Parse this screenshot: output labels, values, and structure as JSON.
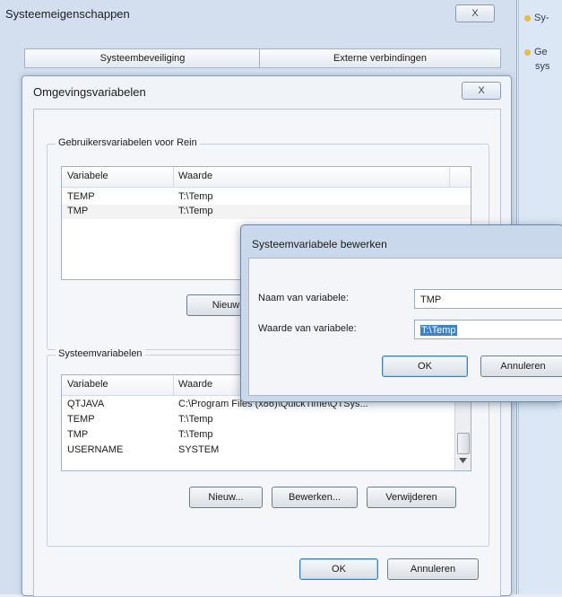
{
  "outer_window": {
    "title": "Systeemeigenschappen",
    "close_glyph": "X",
    "tabs": [
      "Systeembeveiliging",
      "Externe verbindingen"
    ]
  },
  "right_pane": {
    "items": [
      "Sy-",
      "Ge"
    ],
    "item2_sub": "sys"
  },
  "env_dialog": {
    "title": "Omgevingsvariabelen",
    "close_glyph": "X",
    "user_group_label": "Gebruikersvariabelen voor Rein",
    "user_table": {
      "columns": [
        "Variabele",
        "Waarde"
      ],
      "rows": [
        {
          "name": "TEMP",
          "value": "T:\\Temp"
        },
        {
          "name": "TMP",
          "value": "T:\\Temp"
        }
      ]
    },
    "user_new_button": "Nieuw",
    "system_group_label": "Systeemvariabelen",
    "system_table": {
      "columns": [
        "Variabele",
        "Waarde"
      ],
      "rows": [
        {
          "name": "QTJAVA",
          "value": "C:\\Program Files (x86)\\QuickTime\\QTSys..."
        },
        {
          "name": "TEMP",
          "value": "T:\\Temp"
        },
        {
          "name": "TMP",
          "value": "T:\\Temp"
        },
        {
          "name": "USERNAME",
          "value": "SYSTEM"
        }
      ]
    },
    "system_buttons": {
      "new": "Nieuw...",
      "edit": "Bewerken...",
      "delete": "Verwijderen"
    },
    "ok": "OK",
    "cancel": "Annuleren"
  },
  "edit_dialog": {
    "title": "Systeemvariabele bewerken",
    "name_label": "Naam van variabele:",
    "name_value": "TMP",
    "value_label": "Waarde van variabele:",
    "value_value": "T:\\Temp",
    "ok": "OK",
    "cancel": "Annuleren"
  }
}
